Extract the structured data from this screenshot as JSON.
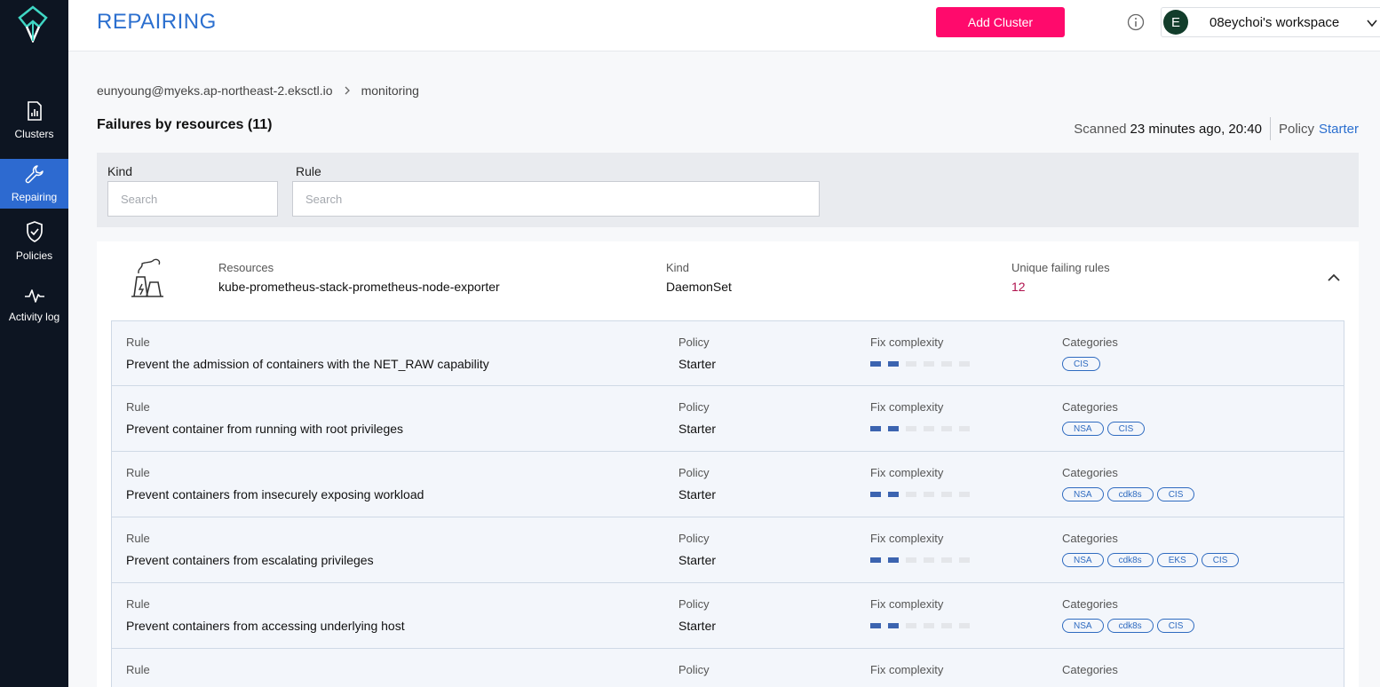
{
  "header": {
    "title": "REPAIRING",
    "add_cluster_label": "Add Cluster",
    "workspace_initial": "E",
    "workspace_name": "08eychoi's workspace"
  },
  "sidebar": {
    "items": [
      {
        "label": "Clusters",
        "icon": "bar-chart-document-icon"
      },
      {
        "label": "Repairing",
        "icon": "wrench-icon",
        "active": true
      },
      {
        "label": "Policies",
        "icon": "shield-check-icon"
      },
      {
        "label": "Activity log",
        "icon": "pulse-icon"
      }
    ]
  },
  "breadcrumb": {
    "cluster": "eunyoung@myeks.ap-northeast-2.eksctl.io",
    "namespace": "monitoring"
  },
  "summary": {
    "title": "Failures by resources (11)",
    "scanned_label": "Scanned",
    "scanned_value": "23 minutes ago, 20:40",
    "policy_label": "Policy",
    "policy_value": "Starter"
  },
  "filters": {
    "kind_label": "Kind",
    "kind_placeholder": "Search",
    "rule_label": "Rule",
    "rule_placeholder": "Search"
  },
  "resource": {
    "resources_label": "Resources",
    "resources_value": "kube-prometheus-stack-prometheus-node-exporter",
    "kind_label": "Kind",
    "kind_value": "DaemonSet",
    "failing_label": "Unique failing rules",
    "failing_value": "12"
  },
  "rules_header": {
    "rule": "Rule",
    "policy": "Policy",
    "complexity": "Fix complexity",
    "categories": "Categories"
  },
  "rules": [
    {
      "name": "Prevent the admission of containers with the NET_RAW capability",
      "policy": "Starter",
      "complexity": 2,
      "categories": [
        "CIS"
      ]
    },
    {
      "name": "Prevent container from running with root privileges",
      "policy": "Starter",
      "complexity": 2,
      "categories": [
        "NSA",
        "CIS"
      ]
    },
    {
      "name": "Prevent containers from insecurely exposing workload",
      "policy": "Starter",
      "complexity": 2,
      "categories": [
        "NSA",
        "cdk8s",
        "CIS"
      ]
    },
    {
      "name": "Prevent containers from escalating privileges",
      "policy": "Starter",
      "complexity": 2,
      "categories": [
        "NSA",
        "cdk8s",
        "EKS",
        "CIS"
      ]
    },
    {
      "name": "Prevent containers from accessing underlying host",
      "policy": "Starter",
      "complexity": 2,
      "categories": [
        "NSA",
        "cdk8s",
        "CIS"
      ]
    }
  ],
  "colors": {
    "accent": "#2b6fcf",
    "add_button": "#ff0a6c",
    "sidebar_bg": "#0d1522",
    "failing_count": "#b0124d"
  }
}
